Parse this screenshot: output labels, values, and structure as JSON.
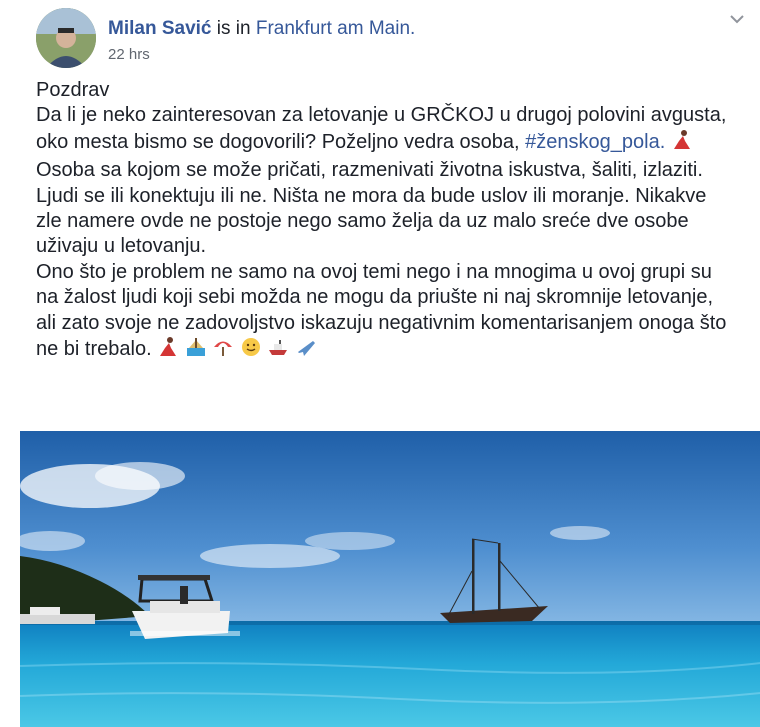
{
  "post": {
    "author": "Milan Savić",
    "is_in_text": "is in",
    "location": "Frankfurt am Main.",
    "timestamp": "22 hrs",
    "greeting": "Pozdrav",
    "line1": "Da li je neko zainteresovan za letovanje u GRČKOJ u drugoj polovini avgusta, oko mesta bismo se dogovorili? Poželjno vedra osoba,",
    "hashtag": "#ženskog_pola.",
    "line2": "Osoba sa kojom se može pričati, razmenivati životna iskustva, šaliti, izlaziti.",
    "paragraph2": "Ljudi se ili konektuju ili ne. Ništa ne mora da bude uslov ili moranje. Nikakve zle namere ovde ne postoje nego samo želja da uz malo sreće dve osobe uživaju u letovanju.",
    "paragraph3": "Ono što je problem ne samo na ovoj temi nego i na mnogima u ovoj grupi su na žalost ljudi koji sebi možda ne mogu da priušte ni naj skromnije letovanje, ali zato svoje ne zadovoljstvo iskazuju negativnim komentarisanjem onoga što ne bi trebalo.",
    "emojis_inline": [
      "dancer-icon"
    ],
    "emojis_end": [
      "dancer-icon",
      "beach-icon",
      "umbrella-icon",
      "smile-icon",
      "ship-icon",
      "airplane-icon"
    ]
  },
  "colors": {
    "link": "#365899",
    "text": "#1d2129",
    "meta": "#616770"
  },
  "photo": {
    "subject": "sea with motorboat and sailing ship"
  }
}
